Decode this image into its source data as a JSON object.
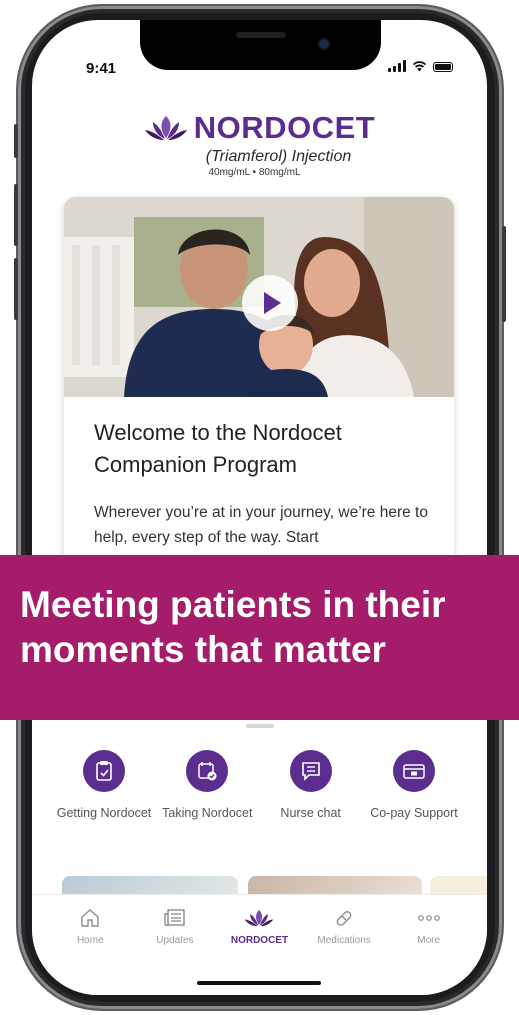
{
  "status": {
    "time": "9:41"
  },
  "brand": {
    "name": "NORDOCET",
    "subtitle": "(Triamferol) Injection",
    "dosage": "40mg/mL • 80mg/mL"
  },
  "card": {
    "title": "Welcome to the Nordocet Companion Program",
    "body": "Wherever you’re at in your journey, we’re here to help, every step of the way. Start"
  },
  "banner": {
    "text": "Meeting patients in their moments that matter"
  },
  "shortcuts": [
    {
      "label": "Getting Nordocet",
      "icon": "calendar-clipboard-icon"
    },
    {
      "label": "Taking Nordocet",
      "icon": "calendar-check-icon"
    },
    {
      "label": "Nurse chat",
      "icon": "chat-icon"
    },
    {
      "label": "Co-pay Support",
      "icon": "card-icon"
    }
  ],
  "tabbar": {
    "items": [
      {
        "label": "Home",
        "icon": "home-icon",
        "active": false
      },
      {
        "label": "Updates",
        "icon": "news-icon",
        "active": false
      },
      {
        "label": "NORDOCET",
        "icon": "lotus-icon",
        "active": true
      },
      {
        "label": "Medications",
        "icon": "pill-icon",
        "active": false
      },
      {
        "label": "More",
        "icon": "more-icon",
        "active": false
      }
    ]
  },
  "colors": {
    "brand_purple": "#5b2d8e",
    "banner_magenta": "#a51d6a"
  }
}
